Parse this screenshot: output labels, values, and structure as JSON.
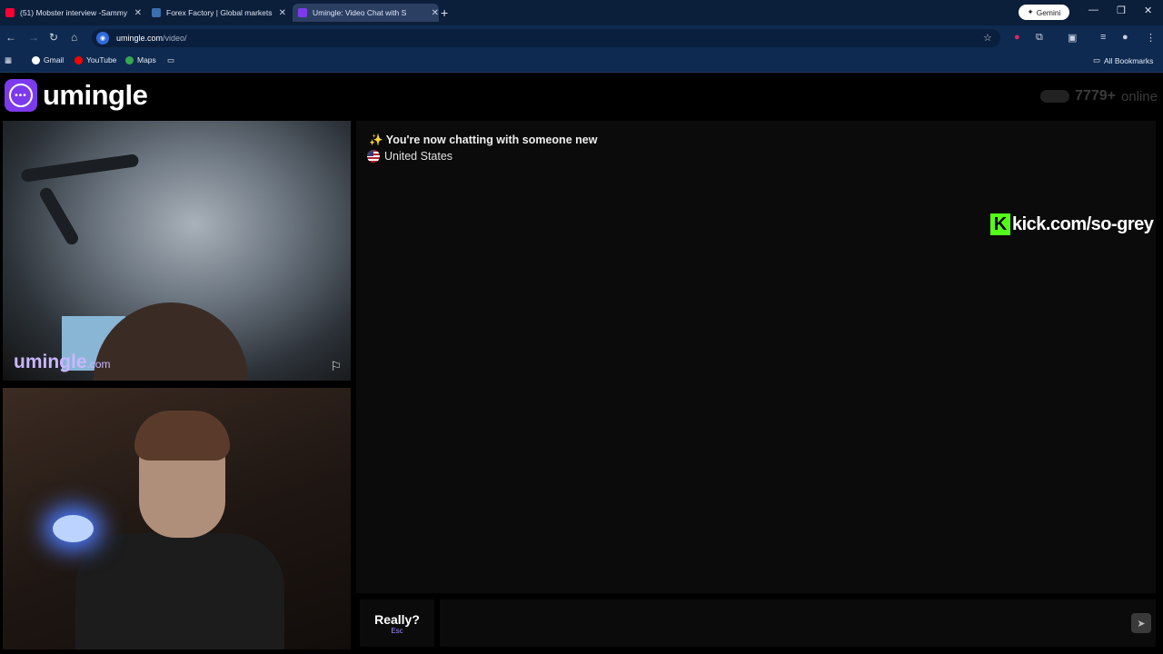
{
  "browser": {
    "tabs": [
      {
        "title": "(51) Mobster interview -Sammy",
        "close": "✕",
        "favicon_color": "#ff0033"
      },
      {
        "title": "Forex Factory | Global markets",
        "close": "✕",
        "favicon_color": "#3a6fb0"
      },
      {
        "title": "Umingle: Video Chat with S",
        "close": "✕",
        "favicon_color": "#7c3aed"
      }
    ],
    "new_tab": "+",
    "gemini_label": "Gemini",
    "url_host": "umingle.com",
    "url_path": "/video/",
    "bookmarks": [
      {
        "label": "Gmail",
        "color": "#ea4335"
      },
      {
        "label": "YouTube",
        "color": "#ff0000"
      },
      {
        "label": "Maps",
        "color": "#34a853"
      }
    ],
    "all_bookmarks": "All Bookmarks"
  },
  "site": {
    "logo_text": "umingle",
    "online_count": "7779+",
    "online_label": "online"
  },
  "video": {
    "watermark_main": "umingle",
    "watermark_suffix": ".com"
  },
  "chat": {
    "status_message": "✨ You're now chatting with someone new",
    "country": "United States"
  },
  "overlay": {
    "k": "K",
    "text": "kick.com/so-grey"
  },
  "controls": {
    "skip_label": "Really?",
    "skip_hint": "Esc",
    "input_placeholder": ""
  }
}
